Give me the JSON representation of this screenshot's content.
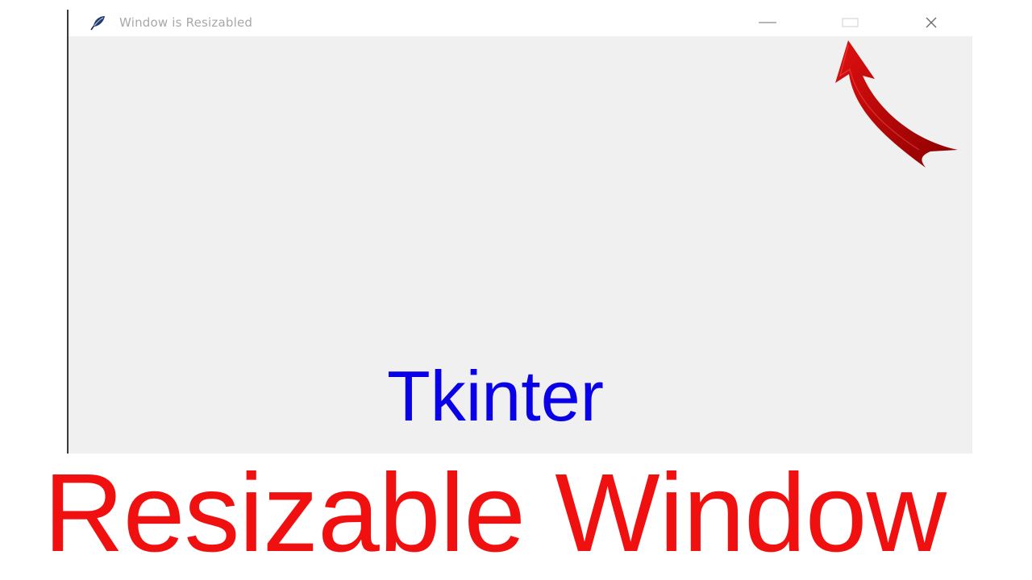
{
  "window": {
    "title": "Window is Resizabled",
    "icon": "tk-feather-icon",
    "controls": {
      "minimize_icon": "minimize-icon",
      "maximize_icon": "maximize-icon",
      "close_icon": "close-icon"
    }
  },
  "overlay": {
    "subtitle": "Tkinter",
    "headline": "Resizable Window",
    "arrow_icon": "curved-arrow-icon"
  },
  "colors": {
    "subtitle": "#0a00e8",
    "headline": "#f01010",
    "arrow": "#c00000",
    "window_bg": "#f0f0f0",
    "titlebar_bg": "#ffffff"
  }
}
